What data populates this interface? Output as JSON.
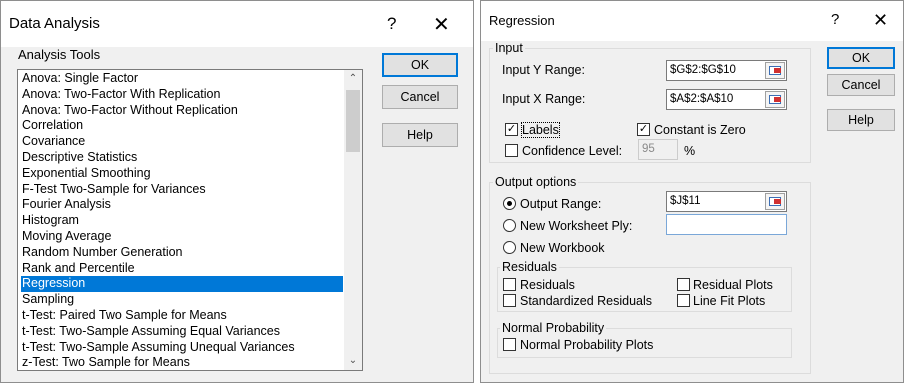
{
  "data_analysis": {
    "title": "Data Analysis",
    "help_glyph": "?",
    "close_glyph": "✕",
    "tools_label": "Analysis Tools",
    "tools": [
      "Anova: Single Factor",
      "Anova: Two-Factor With Replication",
      "Anova: Two-Factor Without Replication",
      "Correlation",
      "Covariance",
      "Descriptive Statistics",
      "Exponential Smoothing",
      "F-Test Two-Sample for Variances",
      "Fourier Analysis",
      "Histogram",
      "Moving Average",
      "Random Number Generation",
      "Rank and Percentile",
      "Regression",
      "Sampling",
      "t-Test: Paired Two Sample for Means",
      "t-Test: Two-Sample Assuming Equal Variances",
      "t-Test: Two-Sample Assuming Unequal Variances",
      "z-Test: Two Sample for Means"
    ],
    "selected_tool": "Regression",
    "buttons": {
      "ok": "OK",
      "cancel": "Cancel",
      "help": "Help"
    }
  },
  "regression": {
    "title": "Regression",
    "help_glyph": "?",
    "close_glyph": "✕",
    "input": {
      "group_label": "Input",
      "y_range_label": "Input Y Range:",
      "y_range_value": "$G$2:$G$10",
      "x_range_label": "Input X Range:",
      "x_range_value": "$A$2:$A$10",
      "labels_label": "Labels",
      "labels_checked": true,
      "constant_zero_label": "Constant is Zero",
      "constant_zero_checked": true,
      "confidence_label": "Confidence Level:",
      "confidence_checked": false,
      "confidence_value": "95",
      "percent_sign": "%"
    },
    "output": {
      "group_label": "Output options",
      "output_range_label": "Output Range:",
      "output_range_value": "$J$11",
      "new_worksheet_label": "New Worksheet Ply:",
      "new_worksheet_value": "",
      "new_workbook_label": "New Workbook",
      "selected": "Output Range"
    },
    "residuals": {
      "group_label": "Residuals",
      "residuals_label": "Residuals",
      "standardized_label": "Standardized Residuals",
      "residual_plots_label": "Residual Plots",
      "line_fit_label": "Line Fit Plots"
    },
    "normal_probability": {
      "group_label": "Normal Probability",
      "plots_label": "Normal Probability Plots"
    },
    "buttons": {
      "ok": "OK",
      "cancel": "Cancel",
      "help": "Help"
    }
  },
  "colors": {
    "selection": "#0078d7",
    "dialog_bg": "#f0f0f0",
    "button_bg": "#e1e1e1"
  }
}
